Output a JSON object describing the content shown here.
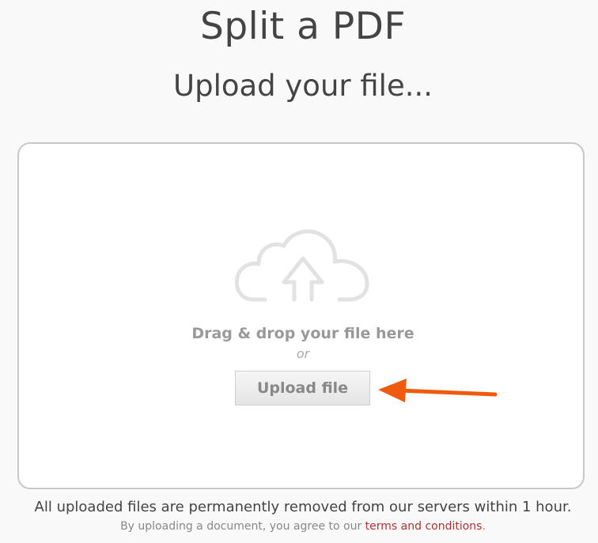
{
  "header": {
    "title": "Split a PDF",
    "subtitle": "Upload your file..."
  },
  "dropzone": {
    "icon": "cloud-upload-icon",
    "drag_text": "Drag & drop your file here",
    "or_text": "or",
    "upload_button_label": "Upload file"
  },
  "annotation": {
    "icon": "arrow-left-icon",
    "color": "#f05a0e"
  },
  "footer": {
    "notice": "All uploaded files are permanently removed from our servers within 1 hour.",
    "terms_prefix": "By uploading a document, you agree to our ",
    "terms_link": "terms and conditions",
    "terms_suffix": "."
  },
  "colors": {
    "background": "#f9f9f9",
    "text_dark": "#444444",
    "text_muted": "#999999",
    "link": "#b03030",
    "border": "#c8c8c8"
  }
}
